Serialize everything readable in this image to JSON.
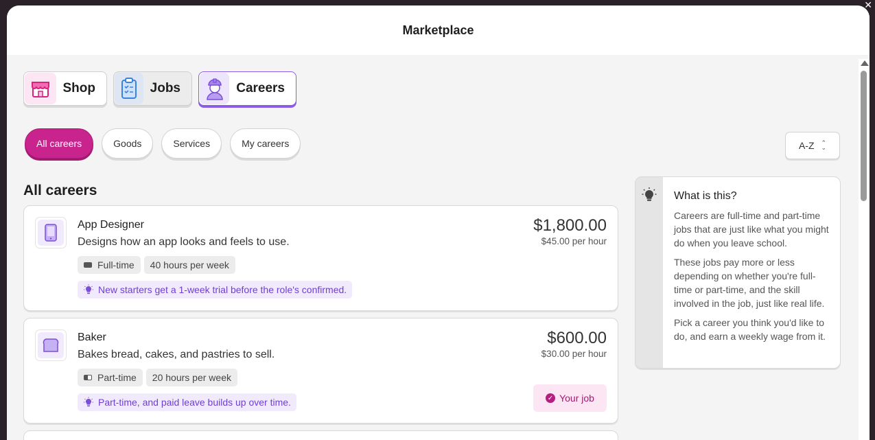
{
  "window": {
    "close_glyph": "✕"
  },
  "modal": {
    "title": "Marketplace"
  },
  "main_tabs": [
    {
      "label": "Shop",
      "icon": "shop-icon"
    },
    {
      "label": "Jobs",
      "icon": "clipboard-icon"
    },
    {
      "label": "Careers",
      "icon": "worker-icon",
      "active": true
    }
  ],
  "filters": [
    {
      "label": "All careers",
      "active": true
    },
    {
      "label": "Goods"
    },
    {
      "label": "Services"
    },
    {
      "label": "My careers"
    }
  ],
  "sort": {
    "label": "A-Z"
  },
  "section": {
    "title": "All careers"
  },
  "careers": [
    {
      "title": "App Designer",
      "description": "Designs how an app looks and feels to use.",
      "icon": "tablet-icon",
      "tags": [
        "Full-time",
        "40 hours per week"
      ],
      "note": "New starters get a 1-week trial before the role's confirmed.",
      "price": "$1,800.00",
      "rate": "$45.00 per hour"
    },
    {
      "title": "Baker",
      "description": "Bakes bread, cakes, and pastries to sell.",
      "icon": "bread-icon",
      "tags": [
        "Part-time",
        "20 hours per week"
      ],
      "note": "Part-time, and paid leave builds up over time.",
      "price": "$600.00",
      "rate": "$30.00 per hour",
      "badge": "Your job"
    }
  ],
  "info": {
    "title": "What is this?",
    "paragraphs": [
      "Careers are full-time and part-time jobs that are just like what you might do when you leave school.",
      "These jobs pay more or less depending on whether you're full-time or part-time, and the skill involved in the job, just like real life.",
      "Pick a career you think you'd like to do, and earn a weekly wage from it."
    ]
  },
  "colors": {
    "accent": "#c9248d",
    "purple": "#8b5ce6",
    "note_text": "#6f3fd0"
  }
}
